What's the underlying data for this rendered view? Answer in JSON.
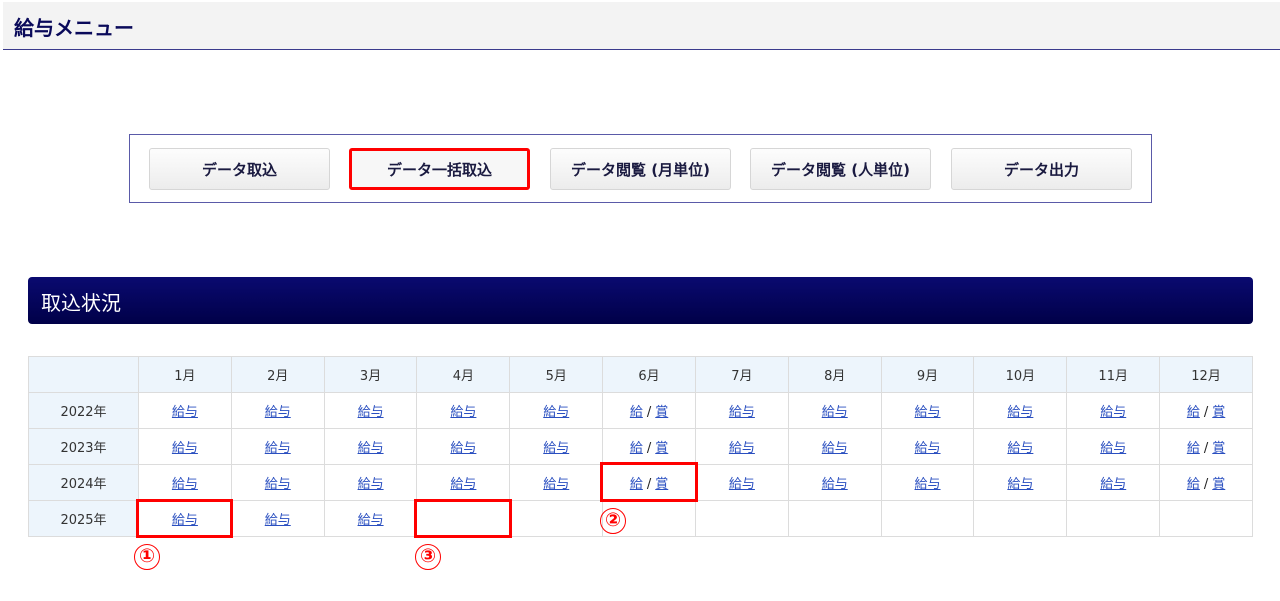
{
  "header": {
    "title": "給与メニュー"
  },
  "buttons": [
    {
      "label": "データ取込"
    },
    {
      "label": "データ一括取込"
    },
    {
      "label": "データ閲覧 (月単位)"
    },
    {
      "label": "データ閲覧 (人単位)"
    },
    {
      "label": "データ出力"
    }
  ],
  "section": {
    "title": "取込状況"
  },
  "table": {
    "months": [
      "1月",
      "2月",
      "3月",
      "4月",
      "5月",
      "6月",
      "7月",
      "8月",
      "9月",
      "10月",
      "11月",
      "12月"
    ],
    "rows": [
      {
        "year": "2022年",
        "cells": [
          "給与",
          "給与",
          "給与",
          "給与",
          "給与",
          [
            "給",
            "賞"
          ],
          "給与",
          "給与",
          "給与",
          "給与",
          "給与",
          [
            "給",
            "賞"
          ]
        ]
      },
      {
        "year": "2023年",
        "cells": [
          "給与",
          "給与",
          "給与",
          "給与",
          "給与",
          [
            "給",
            "賞"
          ],
          "給与",
          "給与",
          "給与",
          "給与",
          "給与",
          [
            "給",
            "賞"
          ]
        ]
      },
      {
        "year": "2024年",
        "cells": [
          "給与",
          "給与",
          "給与",
          "給与",
          "給与",
          [
            "給",
            "賞"
          ],
          "給与",
          "給与",
          "給与",
          "給与",
          "給与",
          [
            "給",
            "賞"
          ]
        ]
      },
      {
        "year": "2025年",
        "cells": [
          "給与",
          "給与",
          "給与",
          "",
          "",
          "",
          "",
          "",
          "",
          "",
          "",
          ""
        ]
      }
    ],
    "separator": "/"
  },
  "annotations": [
    "①",
    "②",
    "③"
  ],
  "colors": {
    "navy": "#000048",
    "highlight": "#ff0000",
    "link": "#2a4fc0"
  }
}
